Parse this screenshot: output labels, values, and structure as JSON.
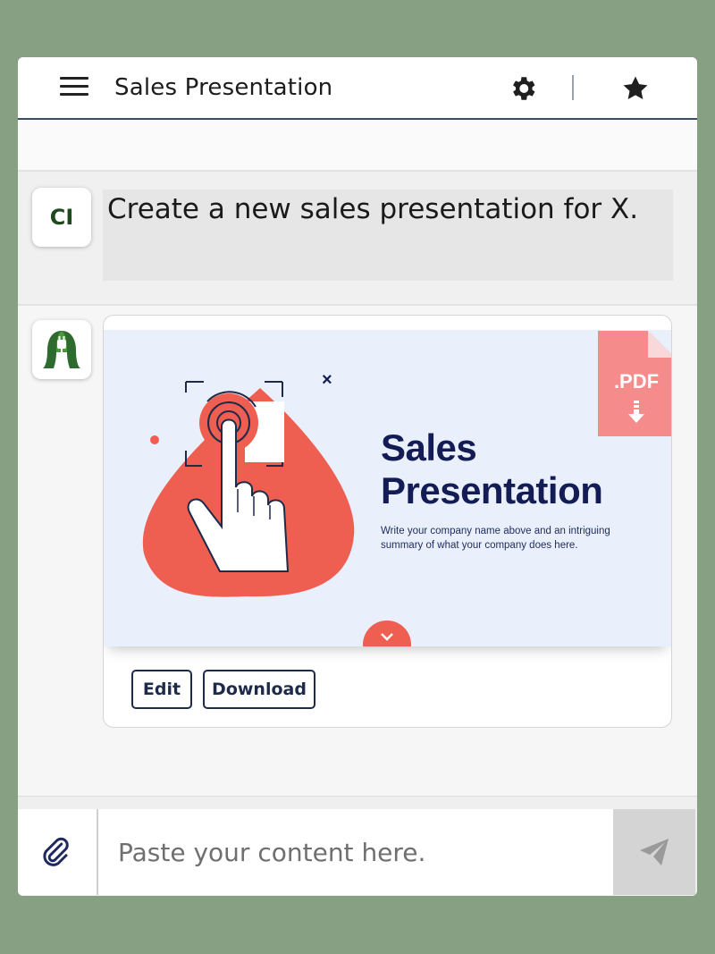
{
  "app": {
    "title": "Sales Presentation"
  },
  "header": {
    "icons": [
      "menu-icon",
      "gear-icon",
      "star-icon"
    ]
  },
  "user_message": {
    "avatar_text": "CI",
    "text": "Create a new sales presentation for X."
  },
  "assistant_message": {
    "avatar_icon": "plug-leaf-logo",
    "slide": {
      "title_line1": "Sales",
      "title_line2": "Presentation",
      "subtitle": "Write your company name above and an intriguing summary of what your company does here."
    },
    "pdf_badge": ".PDF",
    "buttons": {
      "edit": "Edit",
      "download": "Download"
    }
  },
  "composer": {
    "placeholder": "Paste your content here.",
    "value": ""
  },
  "colors": {
    "background": "#87a084",
    "accent_coral": "#ee5f52",
    "navy": "#131c55",
    "pdf_pink": "#f58b8b",
    "logo_green": "#2e6b2e"
  }
}
